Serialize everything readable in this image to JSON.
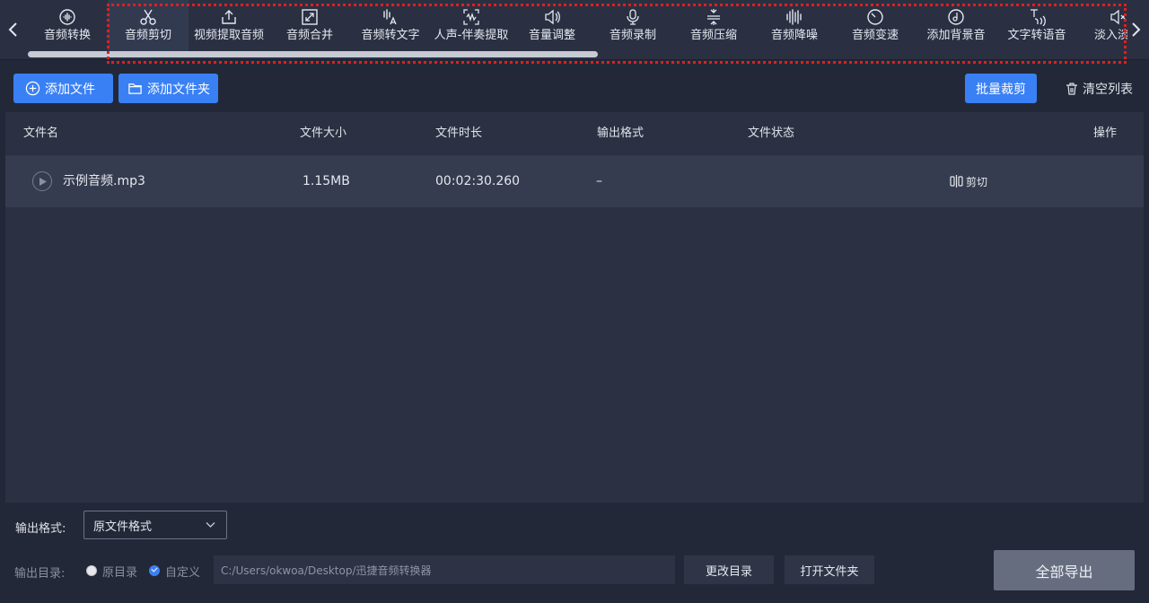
{
  "toolbar": {
    "tools": [
      {
        "label": "音频转换",
        "icon": "audio-convert-icon"
      },
      {
        "label": "音频剪切",
        "icon": "scissors-icon",
        "active": true
      },
      {
        "label": "视频提取音频",
        "icon": "upload-icon"
      },
      {
        "label": "音频合并",
        "icon": "merge-icon"
      },
      {
        "label": "音频转文字",
        "icon": "speech-to-text-icon"
      },
      {
        "label": "人声-伴奏提取",
        "icon": "waveform-extract-icon"
      },
      {
        "label": "音量调整",
        "icon": "volume-icon"
      },
      {
        "label": "音频录制",
        "icon": "microphone-icon"
      },
      {
        "label": "音频压缩",
        "icon": "compress-icon"
      },
      {
        "label": "音频降噪",
        "icon": "denoise-icon"
      },
      {
        "label": "音频变速",
        "icon": "speed-icon"
      },
      {
        "label": "添加背景音",
        "icon": "music-disc-icon"
      },
      {
        "label": "文字转语音",
        "icon": "text-to-speech-icon"
      },
      {
        "label": "淡入淡出",
        "icon": "fade-icon"
      }
    ],
    "scroll_fraction": 0.5
  },
  "actions": {
    "add_file": "添加文件",
    "add_folder": "添加文件夹",
    "batch_cut": "批量裁剪",
    "clear_list": "清空列表"
  },
  "table": {
    "headers": {
      "name": "文件名",
      "size": "文件大小",
      "duration": "文件时长",
      "format": "输出格式",
      "status": "文件状态",
      "op": "操作"
    },
    "rows": [
      {
        "name": "示例音频.mp3",
        "size": "1.15MB",
        "duration": "00:02:30.260",
        "format": "–",
        "status": "",
        "op": "剪切"
      }
    ]
  },
  "bottom": {
    "format_label": "输出格式:",
    "format_value": "原文件格式",
    "dir_label": "输出目录:",
    "radio_original": "原目录",
    "radio_custom": "自定义",
    "selected_radio": "custom",
    "path": "C:/Users/okwoa/Desktop/迅捷音频转换器",
    "change_dir": "更改目录",
    "open_folder": "打开文件夹",
    "export_all": "全部导出"
  },
  "colors": {
    "accent": "#3a80f5",
    "background": "#232838",
    "highlight": "#e01f1f"
  }
}
